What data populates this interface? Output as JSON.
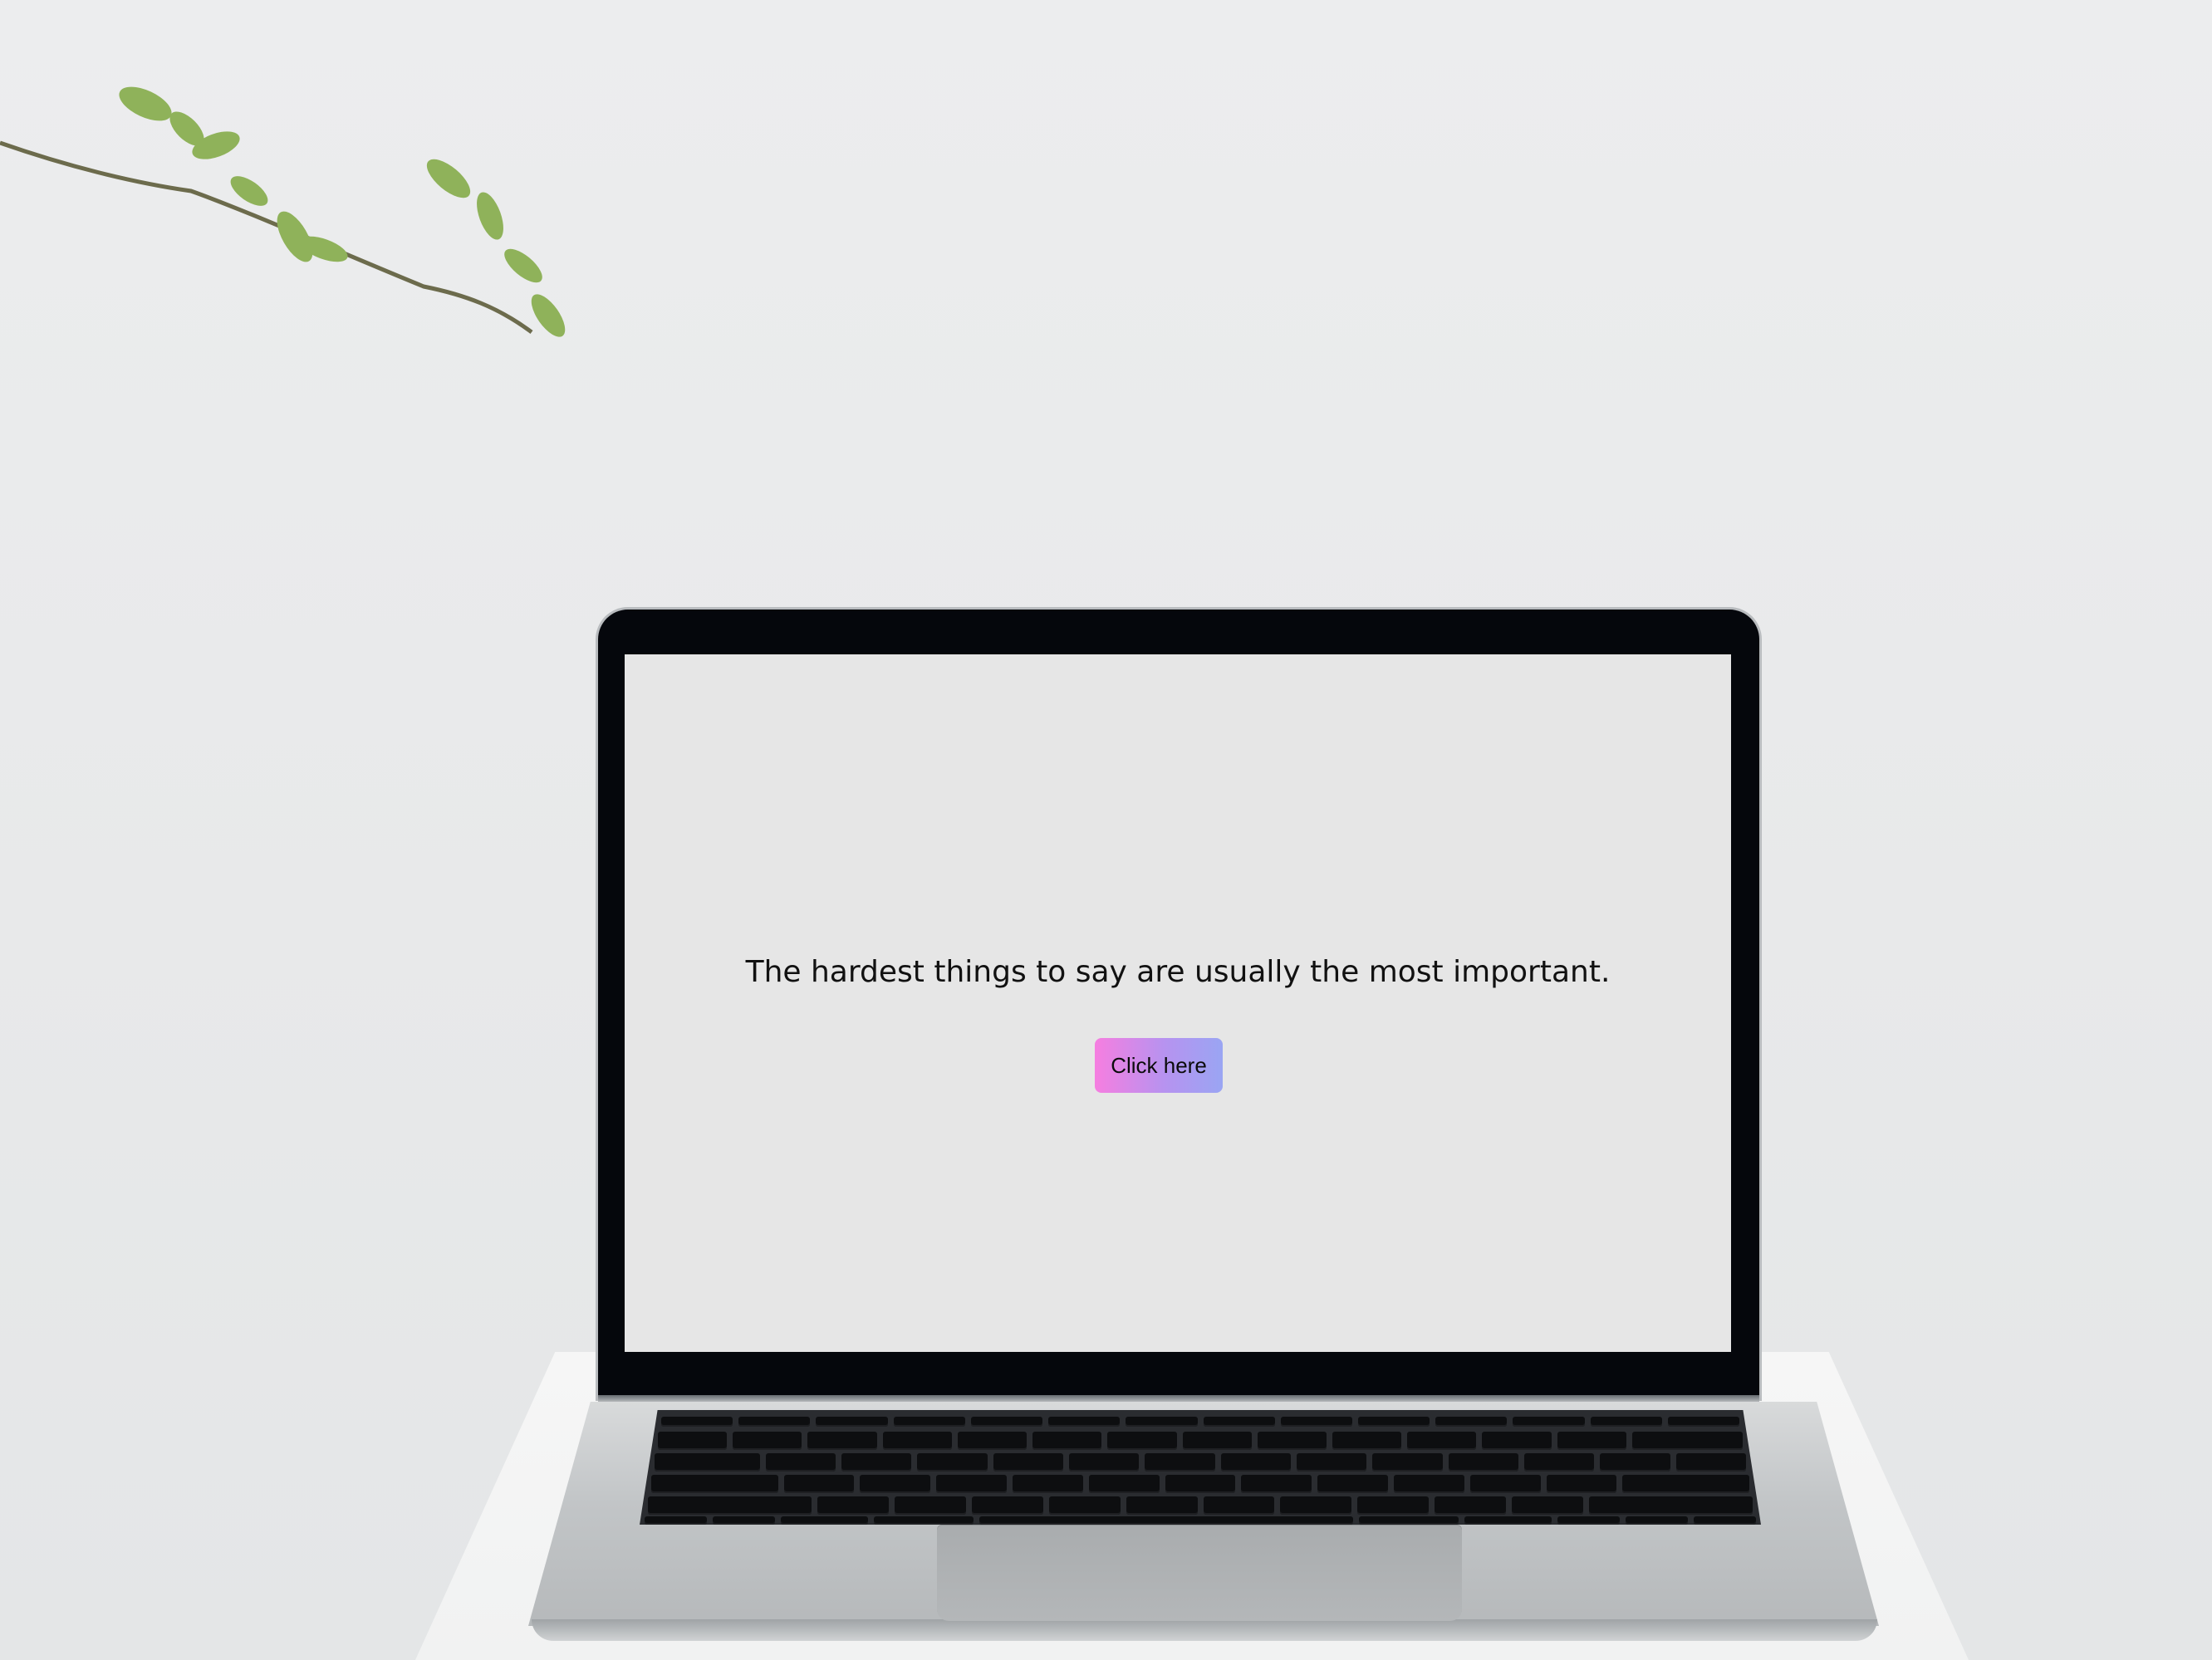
{
  "screen": {
    "quote": "The hardest things to say are usually the most important.",
    "button_label": "Click here"
  },
  "colors": {
    "button_gradient_start": "#f67ee0",
    "button_gradient_end": "#9aa5f3",
    "screen_background": "#e6e6e6",
    "wall_background": "#ecedee"
  }
}
